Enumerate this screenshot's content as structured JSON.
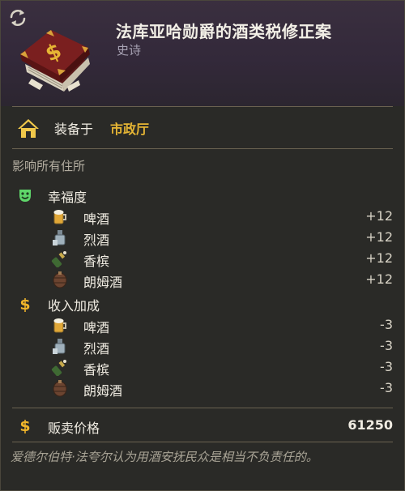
{
  "header": {
    "title": "法库亚哈勋爵的酒类税修正案",
    "rarity": "史诗"
  },
  "equip": {
    "label": "装备于",
    "value": "市政厅"
  },
  "affects_label": "影响所有住所",
  "sections": [
    {
      "title": "幸福度",
      "icon": "happiness-mask-icon",
      "rows": [
        {
          "label": "啤酒",
          "icon": "beer-icon",
          "value": "+12"
        },
        {
          "label": "烈酒",
          "icon": "spirits-icon",
          "value": "+12"
        },
        {
          "label": "香槟",
          "icon": "champagne-icon",
          "value": "+12"
        },
        {
          "label": "朗姆酒",
          "icon": "rum-icon",
          "value": "+12"
        }
      ]
    },
    {
      "title": "收入加成",
      "icon": "gold-dollar-icon",
      "rows": [
        {
          "label": "啤酒",
          "icon": "beer-icon",
          "value": "-3"
        },
        {
          "label": "烈酒",
          "icon": "spirits-icon",
          "value": "-3"
        },
        {
          "label": "香槟",
          "icon": "champagne-icon",
          "value": "-3"
        },
        {
          "label": "朗姆酒",
          "icon": "rum-icon",
          "value": "-3"
        }
      ]
    }
  ],
  "price": {
    "label": "贩卖价格",
    "value": "61250"
  },
  "flavor_text": "爱德尔伯特·法夸尔认为用酒安抚民众是相当不负责任的。",
  "colors": {
    "equip_value": "#e6b534",
    "header_bg": "#3a2f3f",
    "happiness_icon": "#5fd66a",
    "gold_icon": "#f0b52a"
  }
}
